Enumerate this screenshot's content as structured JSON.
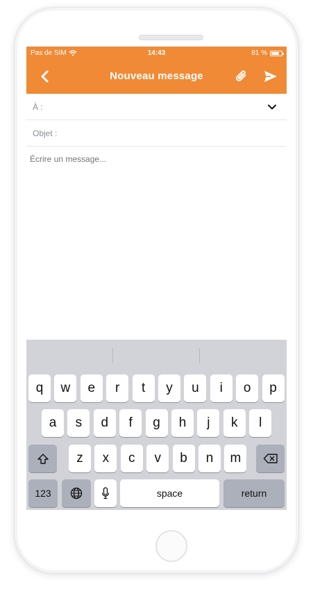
{
  "status_bar": {
    "carrier": "Pas de SIM",
    "time": "14:43",
    "battery": "81 %",
    "battery_level": 0.81
  },
  "nav": {
    "title": "Nouveau message",
    "back_icon": "chevron-left-icon",
    "attach_icon": "paperclip-icon",
    "send_icon": "send-icon"
  },
  "form": {
    "to_label": "À :",
    "subject_label": "Objet :",
    "message_placeholder": "Écrire un message..."
  },
  "keyboard": {
    "row1": [
      "q",
      "w",
      "e",
      "r",
      "t",
      "y",
      "u",
      "i",
      "o",
      "p"
    ],
    "row2": [
      "a",
      "s",
      "d",
      "f",
      "g",
      "h",
      "j",
      "k",
      "l"
    ],
    "row3": [
      "z",
      "x",
      "c",
      "v",
      "b",
      "n",
      "m"
    ],
    "numbers_label": "123",
    "space_label": "space",
    "return_label": "return"
  },
  "colors": {
    "accent": "#f08a36",
    "keyboard_bg": "#d1d3d9",
    "key_dark": "#abb0bb"
  }
}
